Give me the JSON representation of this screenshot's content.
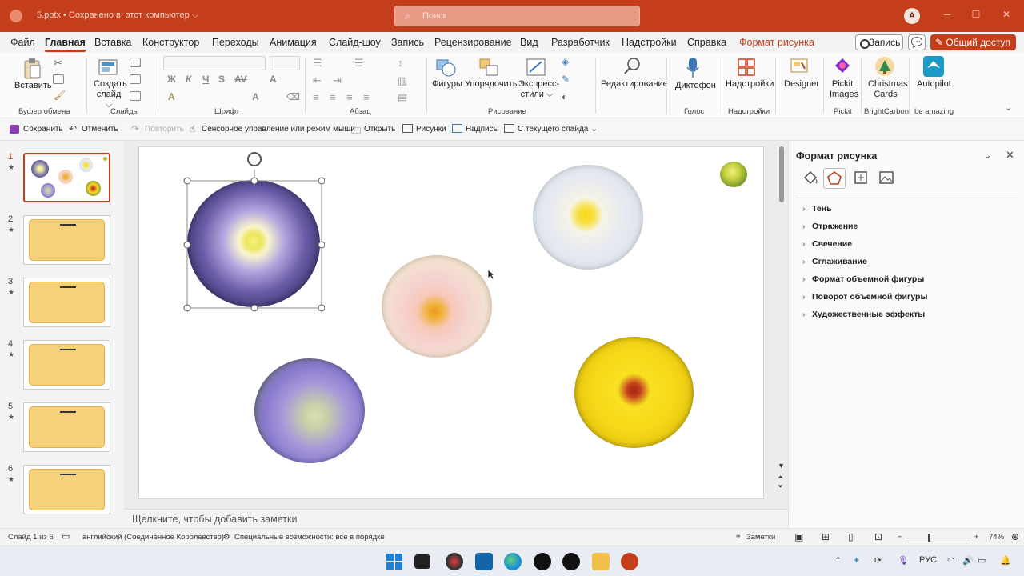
{
  "window": {
    "doc_title": "5.pptx • Сохранено в: этот компьютер ⌵",
    "search_placeholder": "Поиск",
    "avatar_letter": "А",
    "minimize": "─",
    "maximize": "☐",
    "close": "✕"
  },
  "tabs": [
    {
      "label": "Файл"
    },
    {
      "label": "Главная"
    },
    {
      "label": "Вставка"
    },
    {
      "label": "Конструктор"
    },
    {
      "label": "Переходы"
    },
    {
      "label": "Анимация"
    },
    {
      "label": "Слайд-шоу"
    },
    {
      "label": "Запись"
    },
    {
      "label": "Рецензирование"
    },
    {
      "label": "Вид"
    },
    {
      "label": "Разработчик"
    },
    {
      "label": "Надстройки"
    },
    {
      "label": "Справка"
    },
    {
      "label": "Формат рисунка"
    }
  ],
  "header_buttons": {
    "record": "Запись",
    "comment": "💬",
    "share": "✎ Общий доступ ⌵"
  },
  "ribbon": {
    "paste": "Вставить",
    "new_slide": "Создать слайд ⌵",
    "shapes": "Фигуры",
    "arrange": "Упорядочить",
    "quick_styles": "Экспресс-стили ⌵",
    "editing": "Редактирование",
    "dictate": "Диктофон",
    "addins": "Надстройки",
    "designer": "Designer",
    "pickit": "Pickit Images",
    "christmas": "Christmas Cards",
    "autopilot": "Autopilot",
    "groups": {
      "clipboard": "Буфер обмена",
      "slides": "Слайды",
      "font": "Шрифт",
      "paragraph": "Абзац",
      "drawing": "Рисование",
      "voice": "Голос",
      "addins": "Надстройки",
      "pickit": "Pickit",
      "brightcarbon": "BrightCarbon",
      "be_amazing": "be amazing"
    },
    "font_letters": [
      "Ж",
      "К",
      "Ч",
      "S",
      "AV",
      "A",
      "A",
      "A"
    ]
  },
  "qat": {
    "save": "Сохранить",
    "undo": "Отменить",
    "redo": "Повторить",
    "touch_mode": "Сенсорное управление или режим мыши",
    "open": "Открыть",
    "pictures": "Рисунки",
    "caption": "Надпись",
    "from_current": "С текущего слайда"
  },
  "thumbnails": [
    {
      "num": "1",
      "star": "★"
    },
    {
      "num": "2",
      "star": "★"
    },
    {
      "num": "3",
      "star": "★"
    },
    {
      "num": "4",
      "star": "★"
    },
    {
      "num": "5",
      "star": "★"
    },
    {
      "num": "6",
      "star": "★"
    }
  ],
  "notes_placeholder": "Щелкните, чтобы добавить заметки",
  "format_pane": {
    "title": "Формат рисунка",
    "sections": [
      {
        "label": "Тень"
      },
      {
        "label": "Отражение"
      },
      {
        "label": "Свечение"
      },
      {
        "label": "Сглаживание"
      },
      {
        "label": "Формат объемной фигуры"
      },
      {
        "label": "Поворот объемной фигуры"
      },
      {
        "label": "Художественные эффекты"
      }
    ]
  },
  "status": {
    "slide_of": "Слайд 1 из 6",
    "language": "английский (Соединенное Королевство)",
    "accessibility": "Специальные возможности: все в порядке",
    "notes": "Заметки",
    "zoom": "74%"
  },
  "taskbar": {
    "lang": "РУС"
  },
  "colors": {
    "accent": "#c43e1c",
    "titlebar": "#c43e1c",
    "thumb_card": "#f5d27a"
  }
}
